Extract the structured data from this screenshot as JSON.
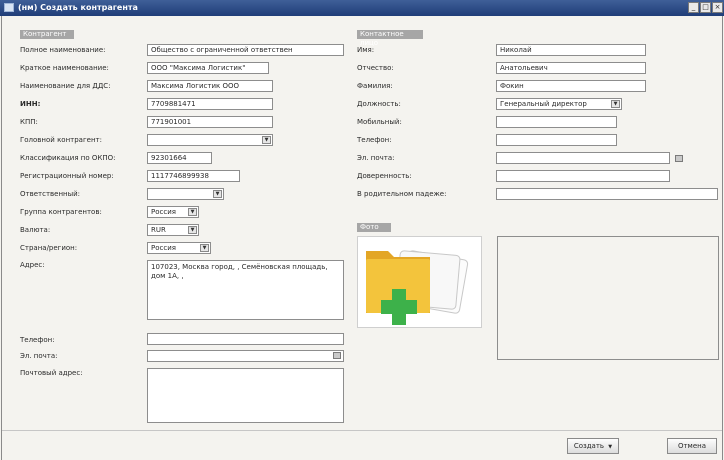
{
  "window": {
    "title": "(нм) Создать контрагента",
    "icon": "window-app-icon"
  },
  "sections": {
    "counterparty": "Контрагент",
    "contact": "Контактное лицо",
    "photo": "Фото"
  },
  "counterparty": {
    "full_name_label": "Полное наименование:",
    "full_name_value": "Общество с ограниченной ответствен",
    "short_name_label": "Краткое наименование:",
    "short_name_value": "ООО \"Максима Логистик\"",
    "dds_name_label": "Наименование для ДДС:",
    "dds_name_value": "Максима Логистик ООО",
    "inn_label": "ИНН:",
    "inn_value": "7709881471",
    "kpp_label": "КПП:",
    "kpp_value": "771901001",
    "head_label": "Головной контрагент:",
    "head_value": "",
    "okpo_label": "Классификация по ОКПО:",
    "okpo_value": "92301664",
    "reg_label": "Регистрационный номер:",
    "reg_value": "1117746899938",
    "resp_label": "Ответственный:",
    "resp_value": "",
    "group_label": "Группа контрагентов:",
    "group_value": "Россия",
    "currency_label": "Валюта:",
    "currency_value": "RUR",
    "country_label": "Страна/регион:",
    "country_value": "Россия",
    "address_label": "Адрес:",
    "address_value": "107023, Москва город, , Семёновская площадь, дом 1А, ,",
    "phone_label": "Телефон:",
    "phone_value": "",
    "email_label": "Эл. почта:",
    "email_value": "",
    "postal_label": "Почтовый адрес:",
    "postal_value": ""
  },
  "contact": {
    "name_label": "Имя:",
    "name_value": "Николай",
    "patronymic_label": "Отчество:",
    "patronymic_value": "Анатольевич",
    "surname_label": "Фамилия:",
    "surname_value": "Фокин",
    "position_label": "Должность:",
    "position_value": "Генеральный директор",
    "mobile_label": "Мобильный:",
    "mobile_value": "",
    "phone_label": "Телефон:",
    "phone_value": "",
    "email_label": "Эл. почта:",
    "email_value": "",
    "power_label": "Доверенность:",
    "power_value": "",
    "genitive_label": "В родительном падеже:",
    "genitive_value": ""
  },
  "buttons": {
    "create": "Создать",
    "cancel": "Отмена"
  },
  "icons": {
    "photo": "add-photo-folder-icon",
    "email": "email-icon"
  }
}
